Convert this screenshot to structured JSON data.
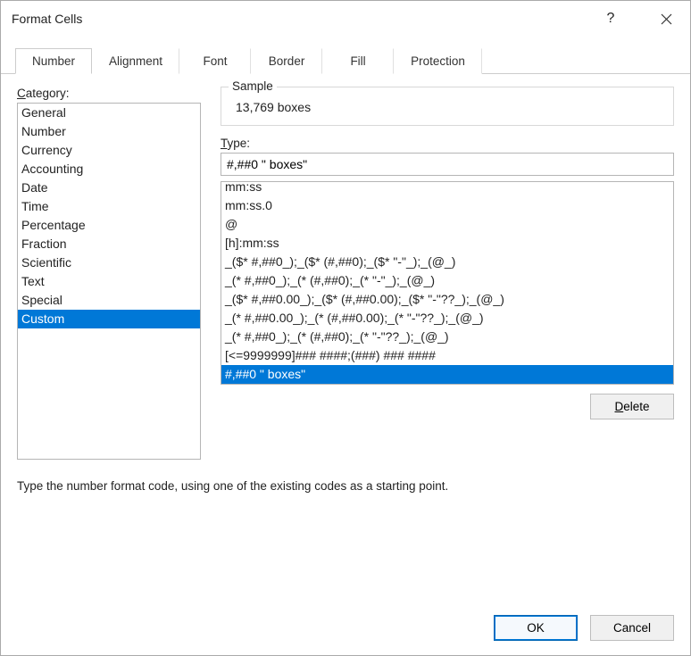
{
  "dialog": {
    "title": "Format Cells",
    "help_symbol": "?",
    "tabs": [
      "Number",
      "Alignment",
      "Font",
      "Border",
      "Fill",
      "Protection"
    ],
    "active_tab_index": 0
  },
  "category": {
    "label_pre": "C",
    "label_post": "ategory:",
    "items": [
      "General",
      "Number",
      "Currency",
      "Accounting",
      "Date",
      "Time",
      "Percentage",
      "Fraction",
      "Scientific",
      "Text",
      "Special",
      "Custom"
    ],
    "selected_index": 11
  },
  "sample": {
    "label": "Sample",
    "value": "13,769  boxes"
  },
  "type": {
    "label_pre": "T",
    "label_post": "ype:",
    "value": "#,##0 \" boxes\"",
    "formats": [
      "mm:ss",
      "mm:ss.0",
      "@",
      "[h]:mm:ss",
      "_($* #,##0_);_($* (#,##0);_($* \"-\"_);_(@_)",
      "_(* #,##0_);_(* (#,##0);_(* \"-\"_);_(@_)",
      "_($* #,##0.00_);_($* (#,##0.00);_($* \"-\"??_);_(@_)",
      "_(* #,##0.00_);_(* (#,##0.00);_(* \"-\"??_);_(@_)",
      "_(* #,##0_);_(* (#,##0);_(* \"-\"??_);_(@_)",
      "[<=9999999]### ####;(###) ### ####",
      "#,##0 \" boxes\""
    ],
    "selected_format_index": 10
  },
  "buttons": {
    "delete_pre": "D",
    "delete_post": "elete",
    "ok": "OK",
    "cancel": "Cancel"
  },
  "hint": "Type the number format code, using one of the existing codes as a starting point."
}
